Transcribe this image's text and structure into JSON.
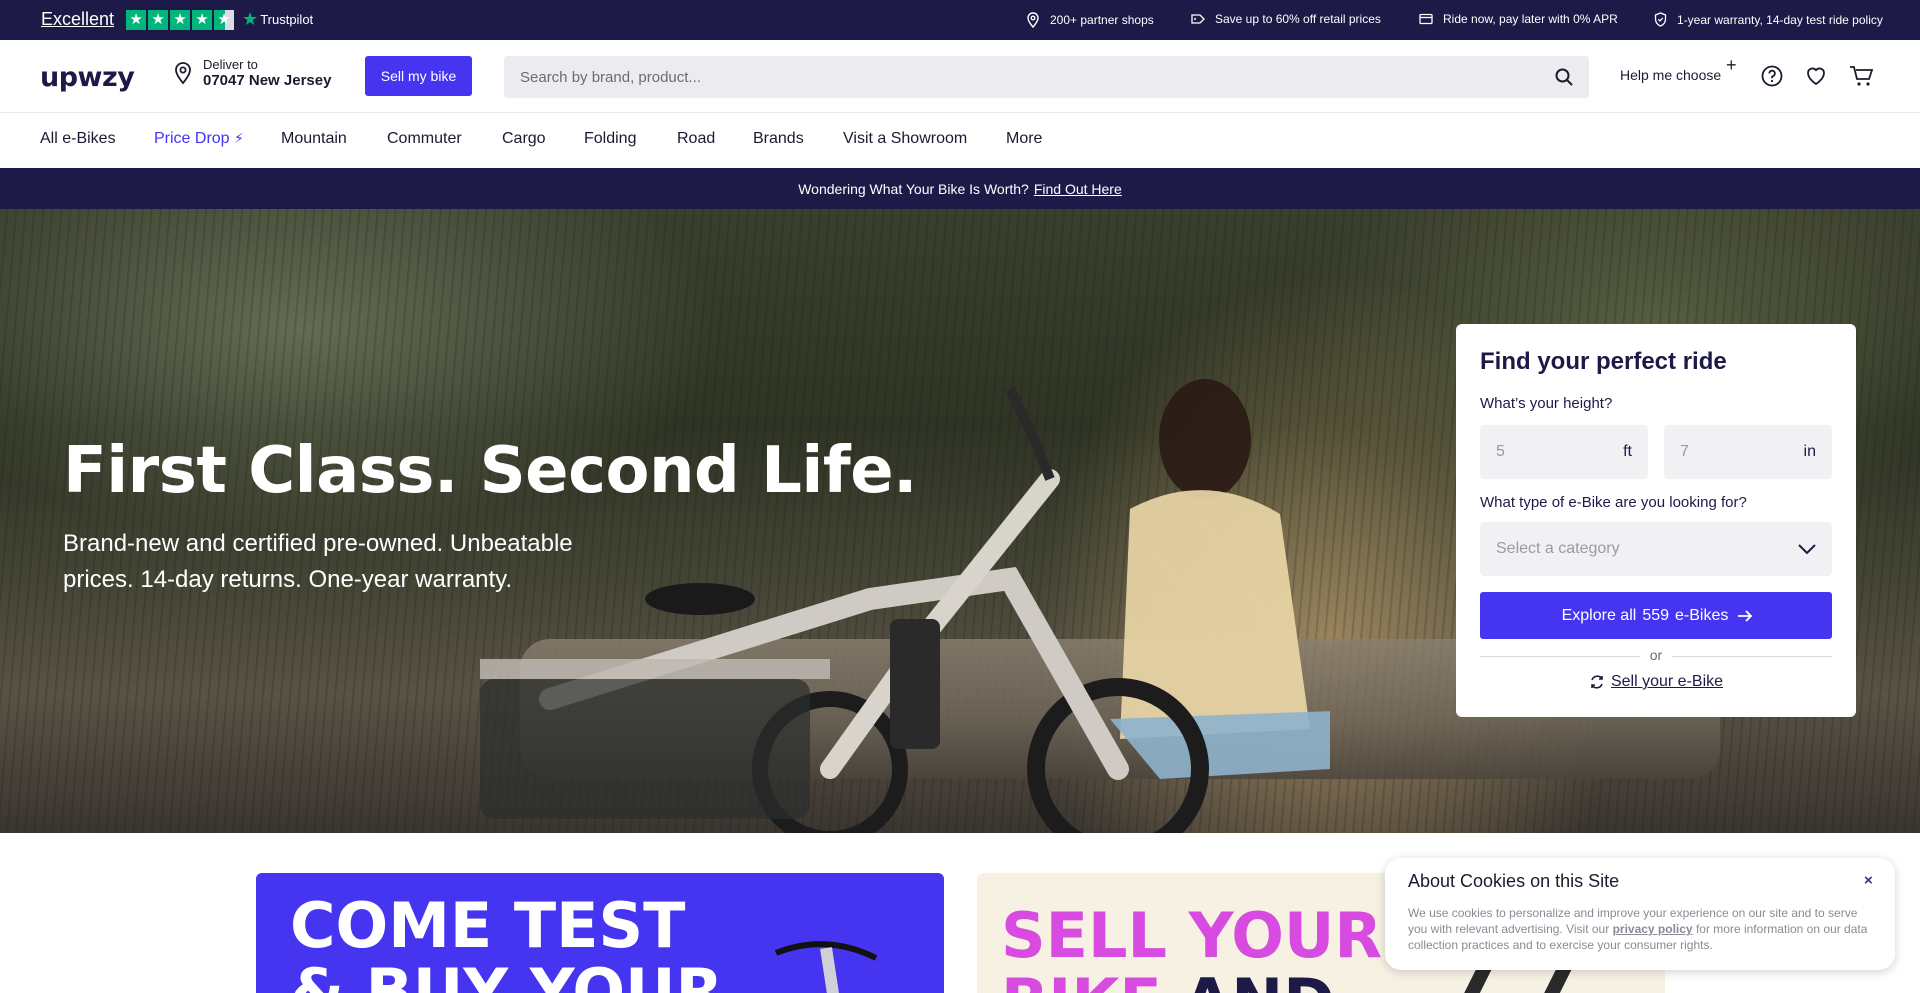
{
  "topbar": {
    "trustpilot": {
      "rating_label": "Excellent",
      "brand": "Trustpilot",
      "stars": 4.5
    },
    "usps": [
      {
        "icon": "map-pin-icon",
        "text": "200+ partner shops"
      },
      {
        "icon": "price-tag-icon",
        "text": "Save up to 60% off retail prices"
      },
      {
        "icon": "credit-card-icon",
        "text": "Ride now, pay later with 0% APR"
      },
      {
        "icon": "shield-check-icon",
        "text": "1-year warranty, 14-day test ride policy"
      }
    ]
  },
  "header": {
    "logo": "upwzy",
    "deliver_label": "Deliver to",
    "deliver_location": "07047 New Jersey",
    "sell_button": "Sell my bike",
    "search_placeholder": "Search by brand, product...",
    "help_label": "Help me choose"
  },
  "nav": {
    "items": [
      {
        "label": "All e-Bikes"
      },
      {
        "label": "Price Drop"
      },
      {
        "label": "Mountain"
      },
      {
        "label": "Commuter"
      },
      {
        "label": "Cargo"
      },
      {
        "label": "Folding"
      },
      {
        "label": "Road"
      },
      {
        "label": "Brands"
      },
      {
        "label": "Visit a Showroom"
      },
      {
        "label": "More"
      }
    ]
  },
  "promo": {
    "text": "Wondering What Your Bike Is Worth?",
    "link": "Find Out Here"
  },
  "hero": {
    "title": "First Class. Second Life.",
    "subtitle": "Brand-new and certified pre-owned. Unbeatable prices. 14-day returns. One-year warranty."
  },
  "finder": {
    "title": "Find your perfect ride",
    "height_label": "What’s your height?",
    "feet_placeholder": "5",
    "feet_unit": "ft",
    "inches_placeholder": "7",
    "inches_unit": "in",
    "type_label": "What type of e-Bike are you looking for?",
    "category_placeholder": "Select a category",
    "explore_prefix": "Explore all",
    "explore_count": "559",
    "explore_suffix": "e-Bikes",
    "or_text": "or",
    "sell_link": "Sell your e-Bike"
  },
  "cards": {
    "test_line1": "COME TEST",
    "test_line2": "& BUY YOUR",
    "sell_line1": "SELL YOUR",
    "sell_line2a": "BIKE",
    "sell_line2b": "AND"
  },
  "cookie": {
    "title": "About Cookies on this Site",
    "close": "×",
    "text_before": "We use cookies to personalize and improve your experience on our site and to serve you with relevant advertising. Visit our",
    "link": "privacy policy",
    "text_after": "for more information on our data collection practices and to exercise your consumer rights."
  },
  "colors": {
    "navy": "#1e1a47",
    "brand_purple": "#4534f0",
    "trustpilot_green": "#00b67a",
    "pink": "#d84be0",
    "cream": "#f6f1e3"
  }
}
